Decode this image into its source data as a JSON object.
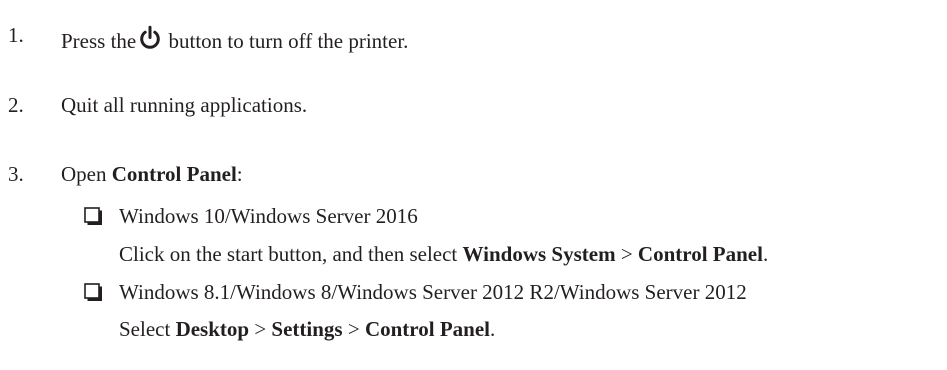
{
  "steps": [
    {
      "number": "1.",
      "text_before": "Press the",
      "icon": "power-icon",
      "text_after": "button to turn off the printer."
    },
    {
      "number": "2.",
      "text": "Quit all running applications."
    },
    {
      "number": "3.",
      "text_before": "Open ",
      "bold": "Control Panel",
      "text_after": ":",
      "options": [
        {
          "checkbox_icon": "checkbox-icon",
          "title": "Windows 10/Windows Server 2016",
          "desc": {
            "t1": "Click on the start button, and then select ",
            "b1": "Windows System",
            "t2": " > ",
            "b2": "Control Panel",
            "t3": "."
          }
        },
        {
          "checkbox_icon": "checkbox-icon",
          "title": "Windows 8.1/Windows 8/Windows Server 2012 R2/Windows Server 2012",
          "desc": {
            "t1": "Select ",
            "b1": "Desktop",
            "t2": " > ",
            "b2": "Settings",
            "t3": " > ",
            "b3": "Control Panel",
            "t4": "."
          }
        }
      ]
    }
  ]
}
